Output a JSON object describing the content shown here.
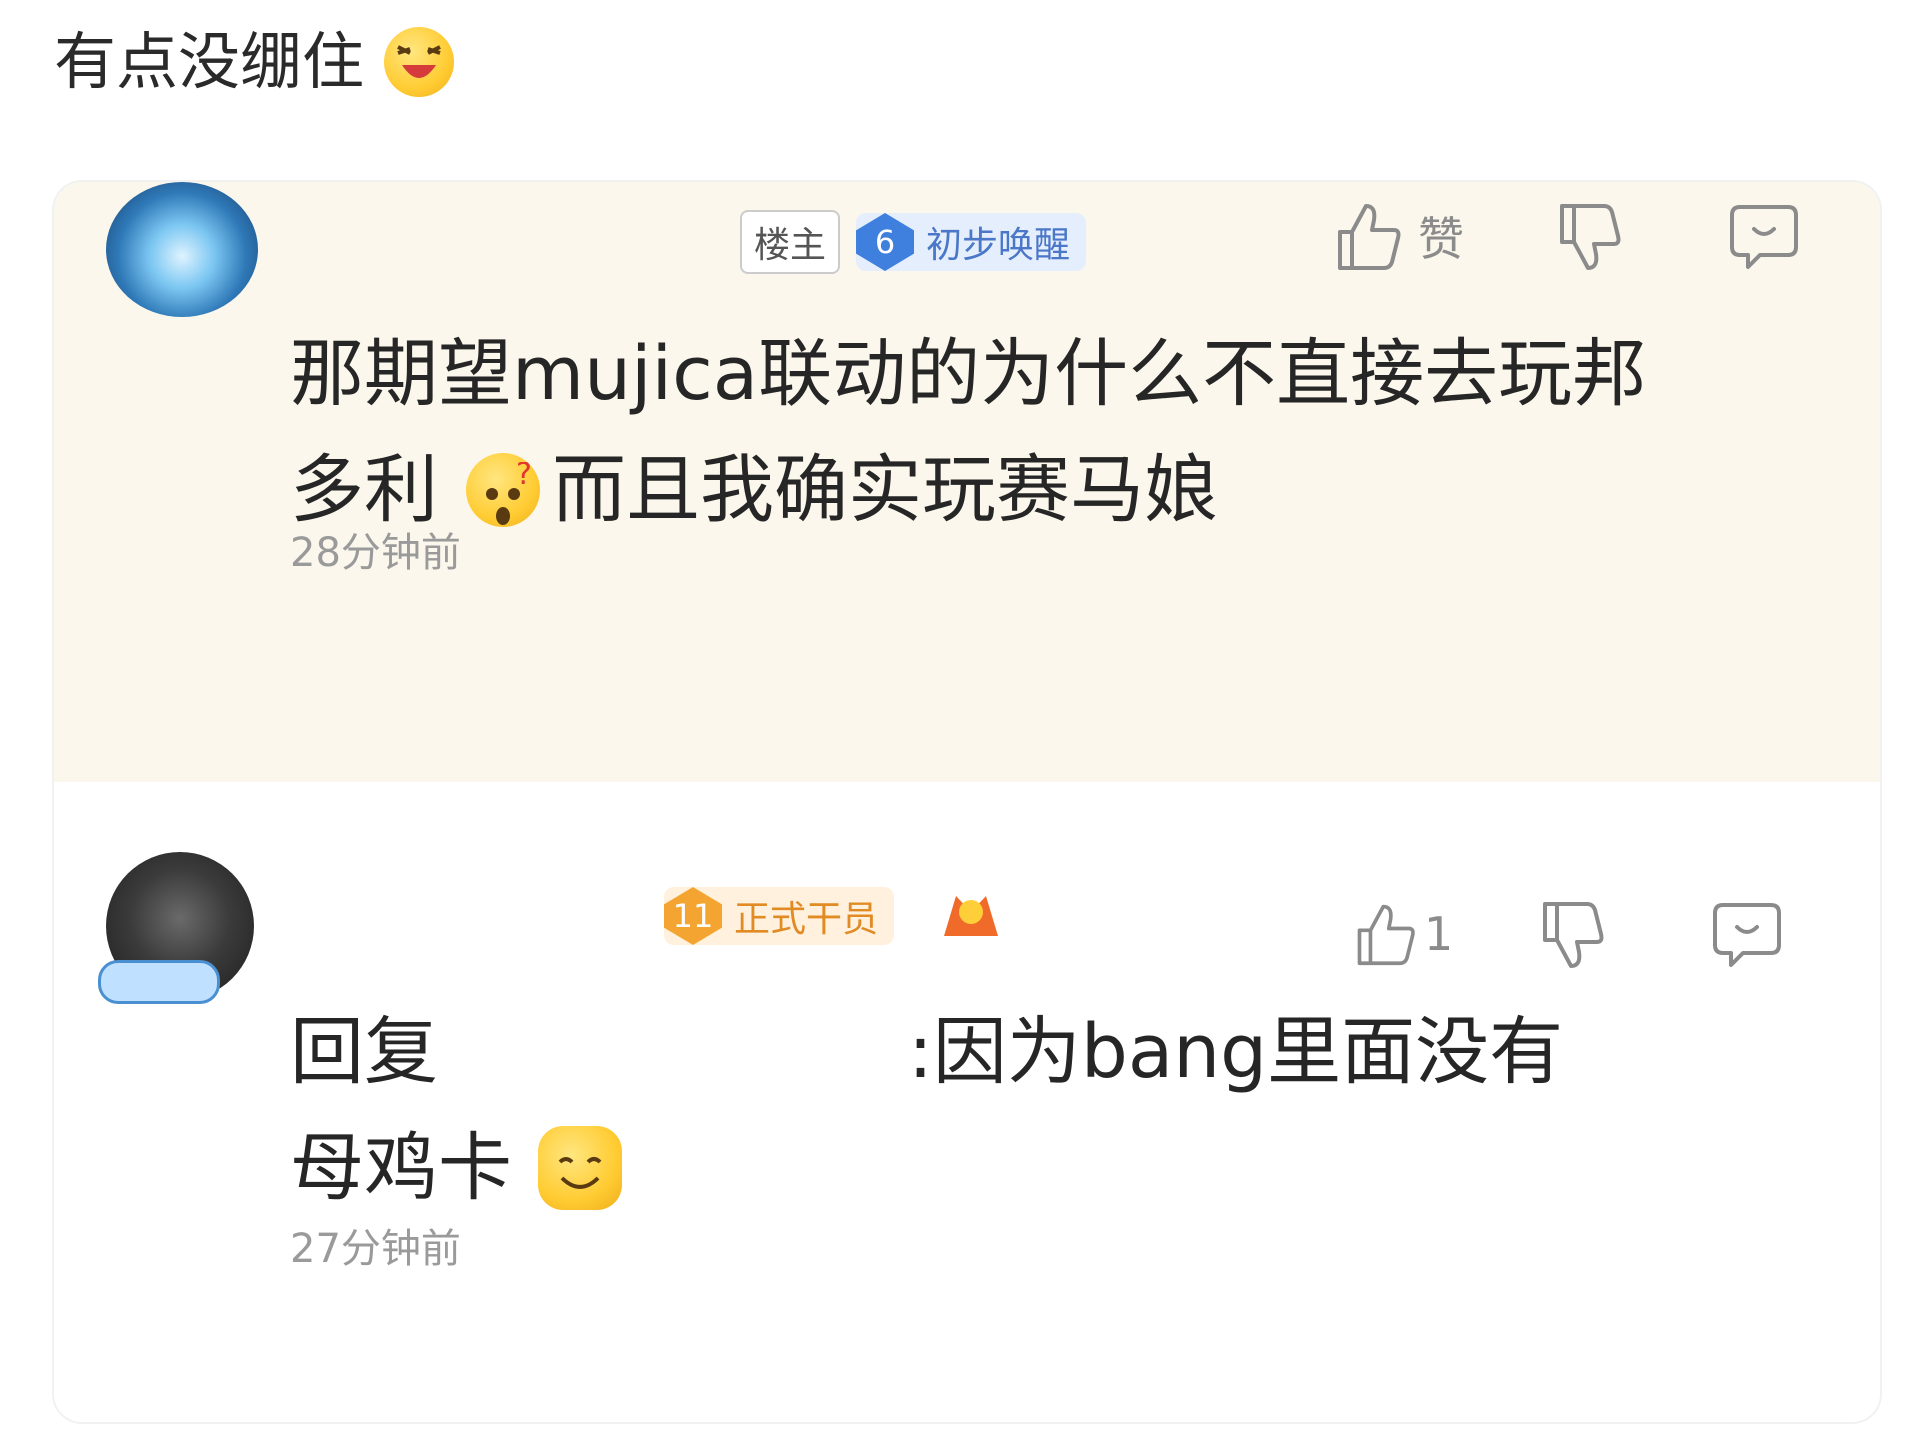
{
  "post": {
    "caption": "有点没绷住"
  },
  "comments": [
    {
      "tag": "楼主",
      "level": "6",
      "level_title": "初步唤醒",
      "like_label": "赞",
      "text_line1": "那期望mujica联动的为什么不直接去玩邦",
      "text_line2_a": "多利",
      "text_line2_b": "而且我确实玩赛马娘",
      "time": "28分钟前"
    },
    {
      "level": "11",
      "level_title": "正式干员",
      "like_count": "1",
      "text_prefix": "回复",
      "text_suffix": ":因为bang里面没有",
      "text_line2": "母鸡卡",
      "time": "27分钟前"
    }
  ],
  "icons": {
    "like": "thumbs-up-icon",
    "dislike": "thumbs-down-icon",
    "reply": "comment-bubble-icon"
  },
  "colors": {
    "highlight_bg": "#fbf7ec",
    "blue_badge": "#3f7fde",
    "gold_badge": "#f4a531"
  }
}
